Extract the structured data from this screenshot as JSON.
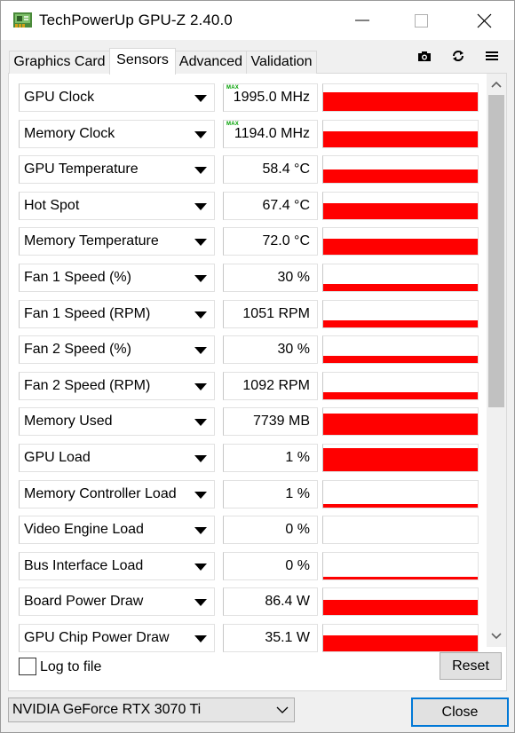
{
  "window": {
    "title": "TechPowerUp GPU-Z 2.40.0"
  },
  "tabs": [
    {
      "label": "Graphics Card",
      "active": false
    },
    {
      "label": "Sensors",
      "active": true
    },
    {
      "label": "Advanced",
      "active": false
    },
    {
      "label": "Validation",
      "active": false
    }
  ],
  "toolbar": {
    "icons": [
      "camera-icon",
      "refresh-icon",
      "menu-icon"
    ]
  },
  "colors": {
    "graph": "#ff0000",
    "focus": "#0078d7",
    "max_tag": "#00a000"
  },
  "max_label": "MAX",
  "sensors": [
    {
      "name": "GPU Clock",
      "value": "1995.0 MHz",
      "show_max": true,
      "graph_level": 0.7
    },
    {
      "name": "Memory Clock",
      "value": "1194.0 MHz",
      "show_max": true,
      "graph_level": 0.6
    },
    {
      "name": "GPU Temperature",
      "value": "58.4 °C",
      "show_max": false,
      "graph_level": 0.5
    },
    {
      "name": "Hot Spot",
      "value": "67.4 °C",
      "show_max": false,
      "graph_level": 0.6
    },
    {
      "name": "Memory Temperature",
      "value": "72.0 °C",
      "show_max": false,
      "graph_level": 0.6
    },
    {
      "name": "Fan 1 Speed (%)",
      "value": "30 %",
      "show_max": false,
      "graph_level": 0.25
    },
    {
      "name": "Fan 1 Speed (RPM)",
      "value": "1051 RPM",
      "show_max": false,
      "graph_level": 0.25
    },
    {
      "name": "Fan 2 Speed (%)",
      "value": "30 %",
      "show_max": false,
      "graph_level": 0.25
    },
    {
      "name": "Fan 2 Speed (RPM)",
      "value": "1092 RPM",
      "show_max": false,
      "graph_level": 0.25
    },
    {
      "name": "Memory Used",
      "value": "7739 MB",
      "show_max": false,
      "graph_level": 0.8
    },
    {
      "name": "GPU Load",
      "value": "1 %",
      "show_max": false,
      "graph_level": 0.85
    },
    {
      "name": "Memory Controller Load",
      "value": "1 %",
      "show_max": false,
      "graph_level": 0.12
    },
    {
      "name": "Video Engine Load",
      "value": "0 %",
      "show_max": false,
      "graph_level": 0.0
    },
    {
      "name": "Bus Interface Load",
      "value": "0 %",
      "show_max": false,
      "graph_level": 0.1
    },
    {
      "name": "Board Power Draw",
      "value": "86.4 W",
      "show_max": false,
      "graph_level": 0.55
    },
    {
      "name": "GPU Chip Power Draw",
      "value": "35.1 W",
      "show_max": false,
      "graph_level": 0.6
    }
  ],
  "footer": {
    "log_label": "Log to file",
    "log_checked": false,
    "reset_label": "Reset",
    "gpu_selected": "NVIDIA GeForce RTX 3070 Ti",
    "close_label": "Close"
  }
}
